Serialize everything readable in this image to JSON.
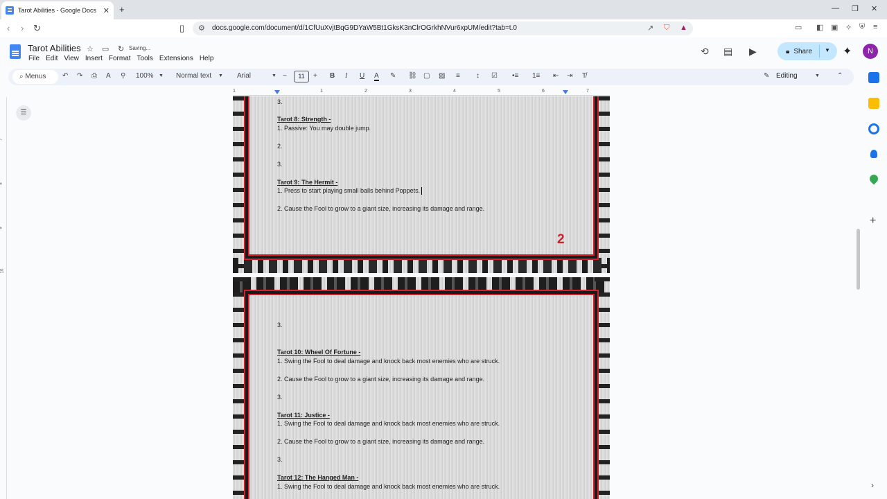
{
  "browser": {
    "tab_title": "Tarot Abilities - Google Docs",
    "tab_close": "✕",
    "new_tab": "+",
    "url": "docs.google.com/document/d/1CfUuXvjtBqG9DYaW5Bt1GksK3nClrOGrkhNVur6xpUM/edit?tab=t.0"
  },
  "doc": {
    "title": "Tarot Abilities",
    "status": "Saving...",
    "menus": [
      "File",
      "Edit",
      "View",
      "Insert",
      "Format",
      "Tools",
      "Extensions",
      "Help"
    ],
    "share_label": "Share",
    "avatar_initial": "N"
  },
  "toolbar": {
    "search_label": "Menus",
    "zoom": "100%",
    "style": "Normal text",
    "font": "Arial",
    "font_size": "11",
    "mode": "Editing"
  },
  "ruler": [
    "1",
    "1",
    "2",
    "3",
    "4",
    "5",
    "6",
    "7"
  ],
  "vruler": [
    "7",
    "8",
    "9",
    "10"
  ],
  "pageA": {
    "lines": [
      {
        "text": "3.",
        "type": "body"
      },
      {
        "text": "Tarot 8: Strength -",
        "type": "heading"
      },
      {
        "text": "1. Passive: You may double jump.",
        "type": "body"
      },
      {
        "text": "2.",
        "type": "body"
      },
      {
        "text": "3.",
        "type": "body"
      },
      {
        "text": "Tarot 9: The Hermit -",
        "type": "heading"
      },
      {
        "text": "1. Press to start playing small balls behind Poppets.",
        "type": "body"
      },
      {
        "text": "2. Cause the Fool to grow to a giant size, increasing its damage and range.",
        "type": "body"
      }
    ],
    "page_number": "2"
  },
  "pageB": {
    "lines": [
      {
        "text": "3.",
        "type": "body"
      },
      {
        "text": "Tarot 10: Wheel Of Fortune -",
        "type": "heading"
      },
      {
        "text": "1. Swing the Fool to deal damage and knock back most enemies who are struck.",
        "type": "body"
      },
      {
        "text": "2. Cause the Fool to grow to a giant size, increasing its damage and range.",
        "type": "body"
      },
      {
        "text": "3.",
        "type": "body"
      },
      {
        "text": "Tarot 11: Justice -",
        "type": "heading"
      },
      {
        "text": "1. Swing the Fool to deal damage and knock back most enemies who are struck.",
        "type": "body"
      },
      {
        "text": "2. Cause the Fool to grow to a giant size, increasing its damage and range.",
        "type": "body"
      },
      {
        "text": "3.",
        "type": "body"
      },
      {
        "text": "Tarot 12: The Hanged Man -",
        "type": "heading"
      },
      {
        "text": "1. Swing the Fool to deal damage and knock back most enemies who are struck.",
        "type": "body"
      }
    ]
  },
  "colors": {
    "accent": "#4285f4",
    "share_bg": "#c2e7ff",
    "frame_red": "#d4202a",
    "avatar": "#8e24aa"
  }
}
